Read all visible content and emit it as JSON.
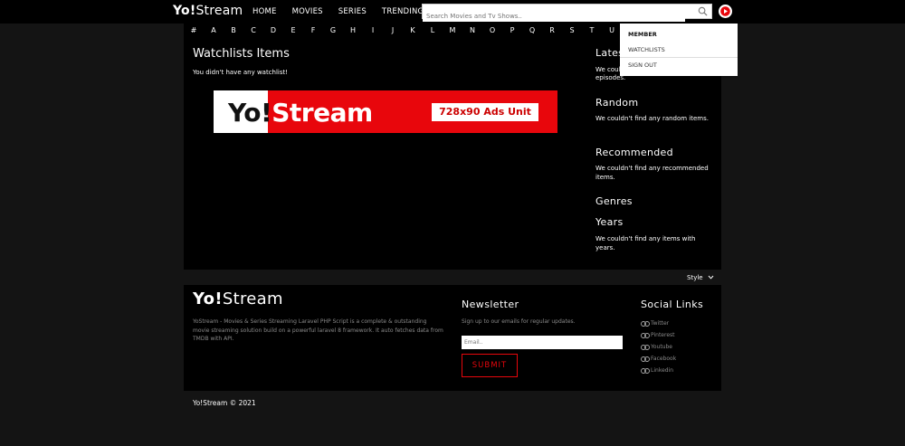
{
  "header": {
    "logo": {
      "bold": "Yo!",
      "rest": "Stream"
    },
    "nav": [
      "HOME",
      "MOVIES",
      "SERIES",
      "TRENDING"
    ],
    "search_placeholder": "Search Movies and Tv Shows.."
  },
  "alphabet": [
    "#",
    "A",
    "B",
    "C",
    "D",
    "E",
    "F",
    "G",
    "H",
    "I",
    "J",
    "K",
    "L",
    "M",
    "N",
    "O",
    "P",
    "Q",
    "R",
    "S",
    "T",
    "U"
  ],
  "dropdown": {
    "header": "MEMBER",
    "items": [
      "WATCHLISTS",
      "SIGN OUT"
    ]
  },
  "main": {
    "title": "Watchlists Items",
    "empty_message": "You didn't have any watchlist!",
    "ad": {
      "logo_bold": "Yo!",
      "logo_rest": "Stream",
      "unit": "728x90 Ads Unit"
    }
  },
  "sidebar": {
    "latest_title": "Lates",
    "latest_text": "We coul",
    "latest_text2": "episodes.",
    "random_title": "Random",
    "random_text": "We couldn't find any random items.",
    "recommended_title": "Recommended",
    "recommended_text": "We couldn't find any recommended items.",
    "genres_title": "Genres",
    "years_title": "Years",
    "years_text": "We couldn't find any items with years."
  },
  "style_toggle": "Style",
  "footer": {
    "logo": {
      "bold": "Yo!",
      "rest": "Stream"
    },
    "description": "YoStream - Movies & Series Streaming Laravel PHP Script is a complete & outstanding movie streaming solution build on a powerful laravel 8 framework. It auto fetches data from TMDB with API.",
    "newsletter_title": "Newsletter",
    "newsletter_sub": "Sign up to our emails for regular updates.",
    "email_placeholder": "Email..",
    "submit": "SUBMIT",
    "social_title": "Social Links",
    "social": [
      "Twitter",
      "Pinterest",
      "Youtube",
      "Facebook",
      "Linkedin"
    ]
  },
  "copyright": "Yo!Stream © 2021",
  "colors": {
    "accent": "#e8060c",
    "background": "#141414",
    "panel": "#000000"
  }
}
